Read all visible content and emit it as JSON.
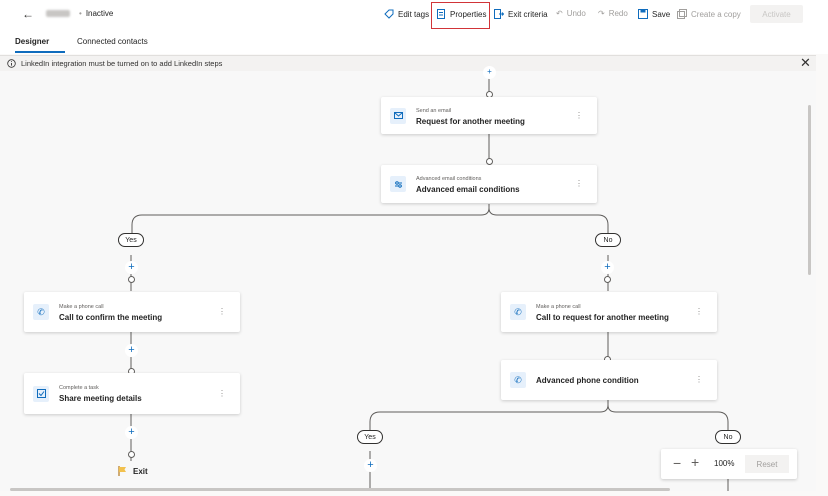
{
  "topbar": {
    "back_icon": "arrow-left-icon",
    "status": "Inactive",
    "edit_tags": "Edit tags",
    "properties": "Properties",
    "exit_criteria": "Exit criteria",
    "undo": "Undo",
    "redo": "Redo",
    "save": "Save",
    "create_copy": "Create a copy",
    "activate": "Activate"
  },
  "tabs": [
    {
      "label": "Designer"
    },
    {
      "label": "Connected contacts"
    }
  ],
  "banner": {
    "text": "LinkedIn integration must be turned on to add LinkedIn steps"
  },
  "nodes": {
    "send_email": {
      "subtitle": "Send an email",
      "title": "Request for another meeting"
    },
    "email_cond": {
      "subtitle": "Advanced email conditions",
      "title": "Advanced email conditions"
    },
    "call_confirm": {
      "subtitle": "Make a phone call",
      "title": "Call to confirm the meeting"
    },
    "call_request": {
      "subtitle": "Make a phone call",
      "title": "Call to request for another meeting"
    },
    "task_share": {
      "subtitle": "Complete a task",
      "title": "Share meeting details"
    },
    "phone_cond": {
      "title": "Advanced phone condition"
    },
    "exit": {
      "label": "Exit"
    }
  },
  "branches": {
    "yes": "Yes",
    "no": "No"
  },
  "zoom": {
    "value": "100%",
    "reset": "Reset"
  },
  "colors": {
    "accent": "#0f6cbd",
    "highlight": "#d13438"
  }
}
